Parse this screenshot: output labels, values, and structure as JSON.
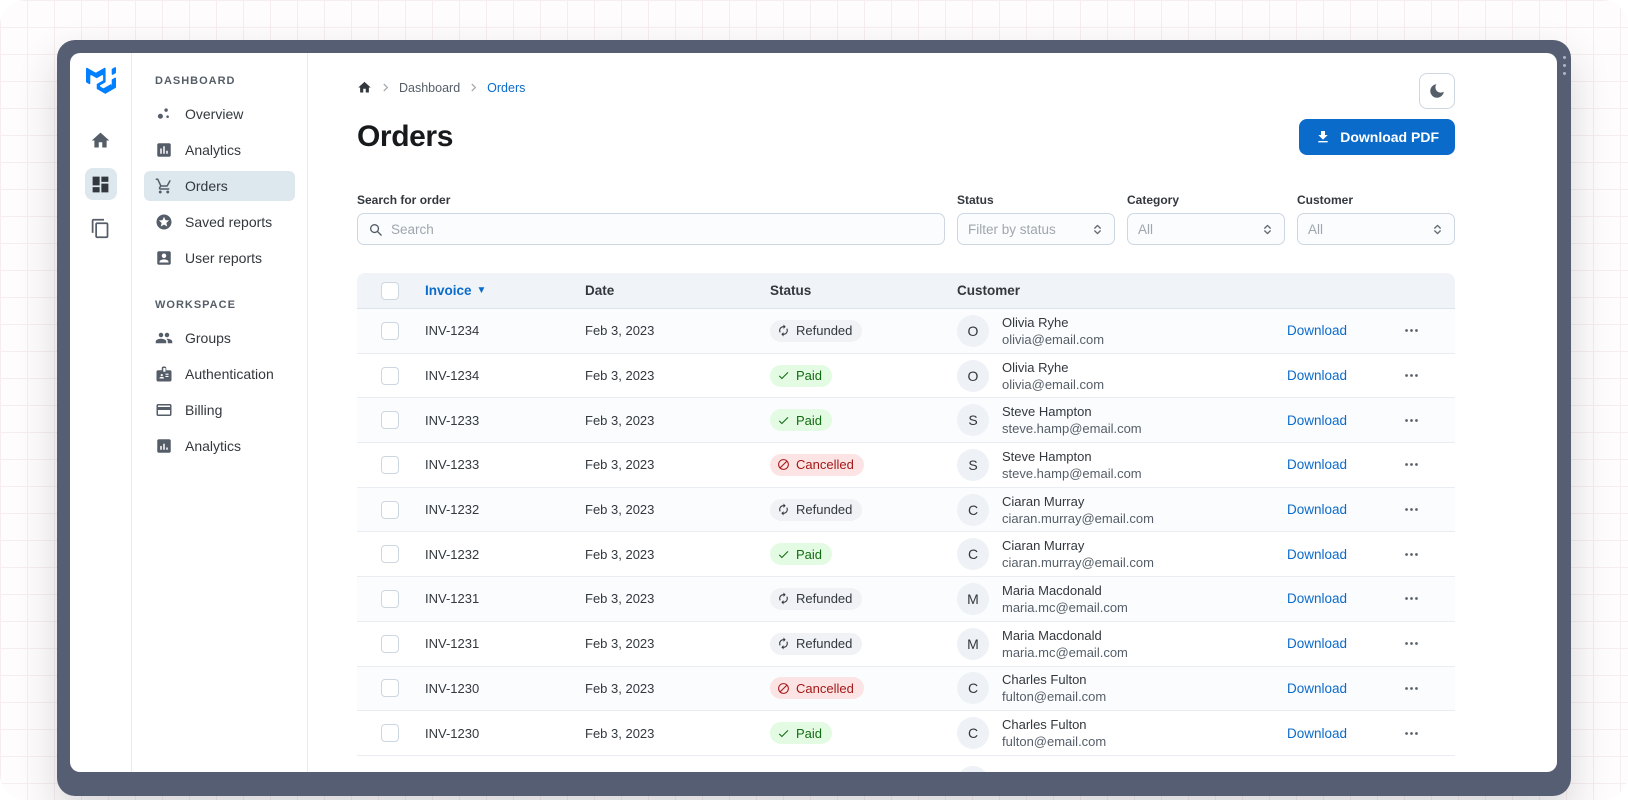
{
  "window": {
    "theme_toggle": "dark-mode"
  },
  "rail": {
    "items": [
      {
        "name": "home",
        "active": false
      },
      {
        "name": "dashboard",
        "active": true
      },
      {
        "name": "layers",
        "active": false
      }
    ]
  },
  "sidebar": {
    "sections": [
      {
        "label": "DASHBOARD",
        "items": [
          {
            "label": "Overview",
            "icon": "bubble-chart",
            "active": false
          },
          {
            "label": "Analytics",
            "icon": "insert-chart",
            "active": false
          },
          {
            "label": "Orders",
            "icon": "shopping-cart",
            "active": true
          },
          {
            "label": "Saved reports",
            "icon": "star-circle",
            "active": false
          },
          {
            "label": "User reports",
            "icon": "person-card",
            "active": false
          }
        ]
      },
      {
        "label": "WORKSPACE",
        "items": [
          {
            "label": "Groups",
            "icon": "people",
            "active": false
          },
          {
            "label": "Authentication",
            "icon": "badge",
            "active": false
          },
          {
            "label": "Billing",
            "icon": "credit-card",
            "active": false
          },
          {
            "label": "Analytics",
            "icon": "chart-square",
            "active": false
          }
        ]
      }
    ]
  },
  "breadcrumb": {
    "items": [
      {
        "label": "Dashboard",
        "current": false
      },
      {
        "label": "Orders",
        "current": true
      }
    ]
  },
  "page": {
    "title": "Orders",
    "download_button": "Download PDF"
  },
  "filters": {
    "search": {
      "label": "Search for order",
      "placeholder": "Search"
    },
    "selects": [
      {
        "label": "Status",
        "value": "Filter by status"
      },
      {
        "label": "Category",
        "value": "All"
      },
      {
        "label": "Customer",
        "value": "All"
      }
    ]
  },
  "table": {
    "columns": [
      "Invoice",
      "Date",
      "Status",
      "Customer"
    ],
    "sort_column": "Invoice",
    "row_action": "Download",
    "rows": [
      {
        "invoice": "INV-1234",
        "date": "Feb 3, 2023",
        "status": "Refunded",
        "initial": "O",
        "name": "Olivia Ryhe",
        "email": "olivia@email.com"
      },
      {
        "invoice": "INV-1234",
        "date": "Feb 3, 2023",
        "status": "Paid",
        "initial": "O",
        "name": "Olivia Ryhe",
        "email": "olivia@email.com"
      },
      {
        "invoice": "INV-1233",
        "date": "Feb 3, 2023",
        "status": "Paid",
        "initial": "S",
        "name": "Steve Hampton",
        "email": "steve.hamp@email.com"
      },
      {
        "invoice": "INV-1233",
        "date": "Feb 3, 2023",
        "status": "Cancelled",
        "initial": "S",
        "name": "Steve Hampton",
        "email": "steve.hamp@email.com"
      },
      {
        "invoice": "INV-1232",
        "date": "Feb 3, 2023",
        "status": "Refunded",
        "initial": "C",
        "name": "Ciaran Murray",
        "email": "ciaran.murray@email.com"
      },
      {
        "invoice": "INV-1232",
        "date": "Feb 3, 2023",
        "status": "Paid",
        "initial": "C",
        "name": "Ciaran Murray",
        "email": "ciaran.murray@email.com"
      },
      {
        "invoice": "INV-1231",
        "date": "Feb 3, 2023",
        "status": "Refunded",
        "initial": "M",
        "name": "Maria Macdonald",
        "email": "maria.mc@email.com"
      },
      {
        "invoice": "INV-1231",
        "date": "Feb 3, 2023",
        "status": "Refunded",
        "initial": "M",
        "name": "Maria Macdonald",
        "email": "maria.mc@email.com"
      },
      {
        "invoice": "INV-1230",
        "date": "Feb 3, 2023",
        "status": "Cancelled",
        "initial": "C",
        "name": "Charles Fulton",
        "email": "fulton@email.com"
      },
      {
        "invoice": "INV-1230",
        "date": "Feb 3, 2023",
        "status": "Paid",
        "initial": "C",
        "name": "Charles Fulton",
        "email": "fulton@email.com"
      }
    ],
    "status_variants": {
      "Paid": "success",
      "Refunded": "neutral",
      "Cancelled": "danger"
    }
  },
  "colors": {
    "primary": "#0b6bcb",
    "frame": "#565e73",
    "header_bg": "#f0f4f8",
    "chip_neutral_bg": "#f0f2f5",
    "chip_success_bg": "#e3fbe3",
    "chip_success_text": "#136c13",
    "chip_danger_bg": "#fce4e4",
    "chip_danger_text": "#a51818",
    "sidebar_selected_bg": "#dde7ee"
  }
}
